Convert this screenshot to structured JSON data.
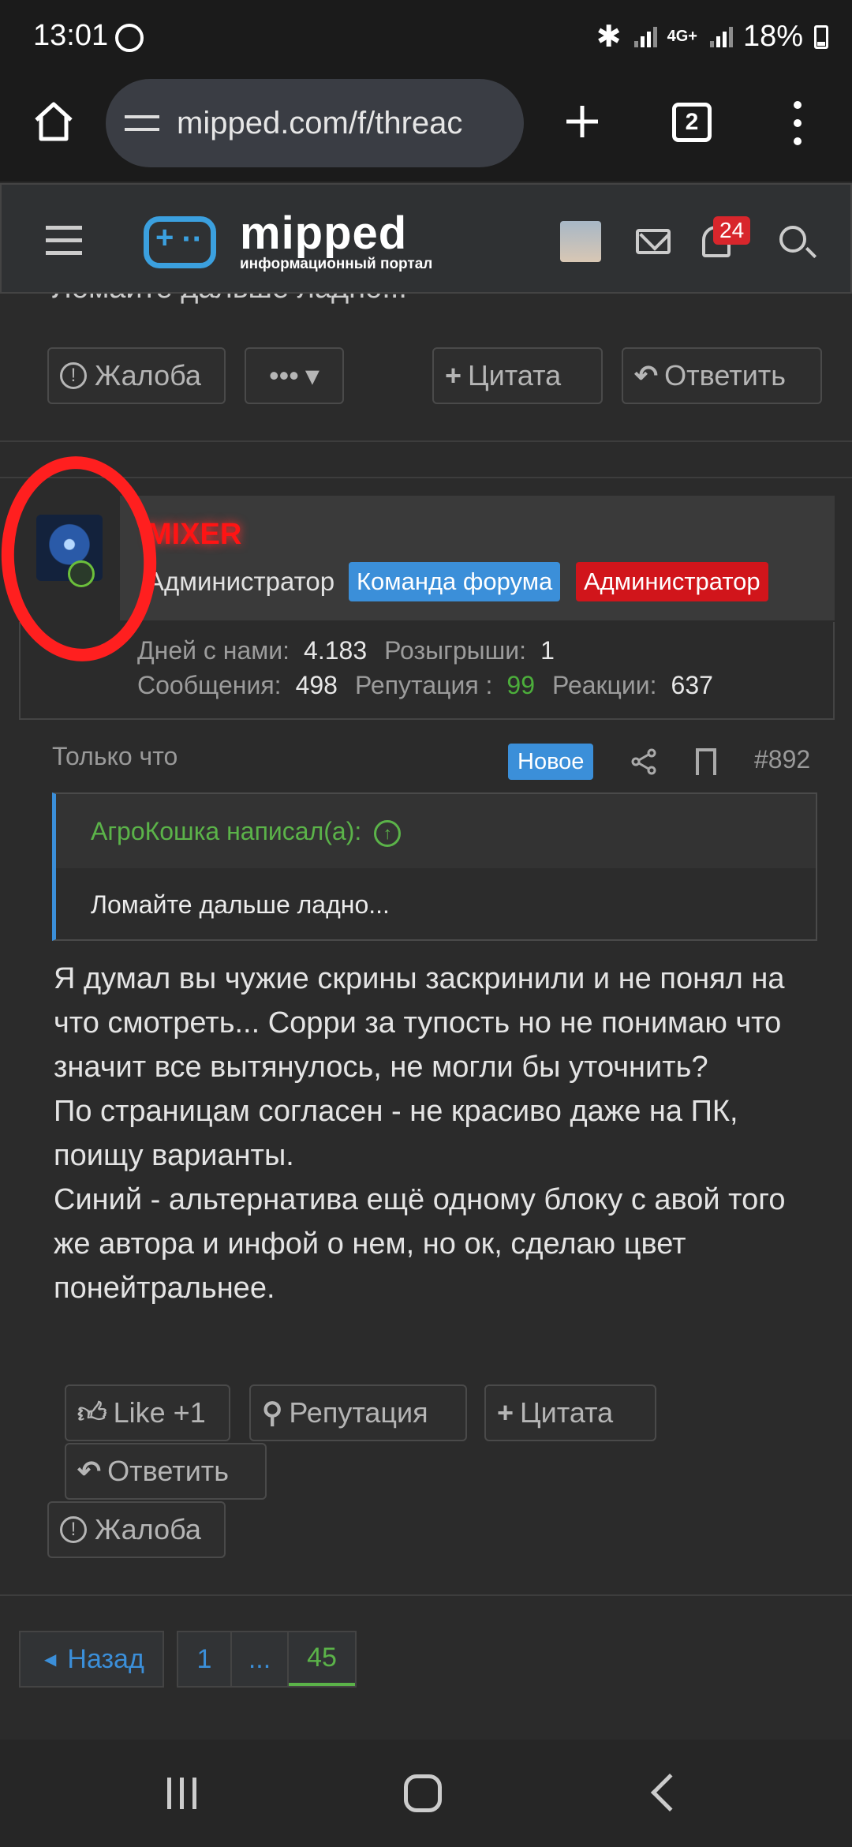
{
  "status": {
    "time": "13:01",
    "network": "4G+",
    "battery": "18%"
  },
  "browser": {
    "url": "mipped.com/f/threac",
    "tab_count": "2"
  },
  "site": {
    "logo_name": "mipped",
    "logo_tagline": "информационный портал",
    "notification_count": "24"
  },
  "prev_post": {
    "peek_text": "Ломайте дальше ладно...",
    "report_label": "Жалоба",
    "more_label": "•••",
    "quote_label": "Цитата",
    "reply_label": "Ответить"
  },
  "post": {
    "username": "MIXER",
    "user_title": "Администратор",
    "banners": [
      "Команда форума",
      "Администратор"
    ],
    "stats": {
      "days_label": "Дней с нами:",
      "days_value": "4.183",
      "giveaways_label": "Розыгрыши:",
      "giveaways_value": "1",
      "messages_label": "Сообщения:",
      "messages_value": "498",
      "reputation_label": "Репутация :",
      "reputation_value": "99",
      "reactions_label": "Реакции:",
      "reactions_value": "637"
    },
    "date": "Только что",
    "new_tag": "Новое",
    "post_number": "#892",
    "quote": {
      "author": "АгроКошка написал(а):",
      "text": "Ломайте дальше ладно..."
    },
    "body": [
      "Я думал вы чужие скрины заскринили и не понял на что смотреть... Сорри за тупость но не понимаю что значит все вытянулось, не могли бы уточнить?",
      "По страницам согласен - не красиво даже на ПК, поищу варианты.",
      "Синий - альтернатива ещё одному блоку с авой того же автора и инфой о нем, но ок, сделаю цвет понейтральнее."
    ],
    "actions": {
      "like_label": "Like +1",
      "reputation_label": "Репутация",
      "quote_label": "Цитата",
      "reply_label": "Ответить",
      "report_label": "Жалоба"
    }
  },
  "pagination": {
    "back_label": "Назад",
    "pages": [
      "1",
      "...",
      "45"
    ],
    "current": "45"
  },
  "colors": {
    "accent_blue": "#3b8fd9",
    "admin_red": "#d1151b",
    "positive_green": "#5bb349"
  }
}
